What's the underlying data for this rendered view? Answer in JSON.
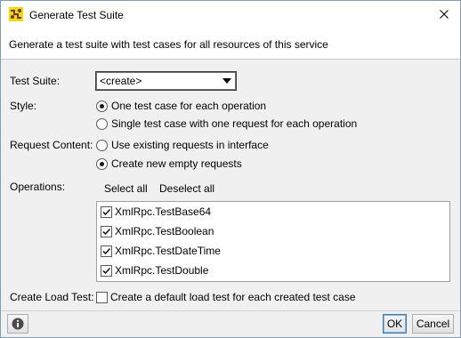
{
  "window": {
    "title": "Generate Test Suite"
  },
  "banner": {
    "text": "Generate a test suite with test cases for all resources of this service"
  },
  "form": {
    "test_suite_label": "Test Suite:",
    "test_suite_value": "<create>",
    "style_label": "Style:",
    "style_options": [
      {
        "label": "One test case for each operation",
        "selected": true
      },
      {
        "label": "Single test case with one request for each operation",
        "selected": false
      }
    ],
    "request_content_label": "Request Content:",
    "request_content_options": [
      {
        "label": "Use existing requests in interface",
        "selected": false
      },
      {
        "label": "Create new empty requests",
        "selected": true
      }
    ],
    "operations_label": "Operations:",
    "select_all": "Select all",
    "deselect_all": "Deselect all",
    "operations": [
      {
        "label": "XmlRpc.TestBase64",
        "checked": true
      },
      {
        "label": "XmlRpc.TestBoolean",
        "checked": true
      },
      {
        "label": "XmlRpc.TestDateTime",
        "checked": true
      },
      {
        "label": "XmlRpc.TestDouble",
        "checked": true
      }
    ],
    "create_load_test_label": "Create Load Test:",
    "create_load_test_option": "Create a default load test for each created test case",
    "create_load_test_checked": false
  },
  "buttons": {
    "ok": "OK",
    "cancel": "Cancel"
  },
  "colors": {
    "accent": "#3c7fb1",
    "icon_yellow": "#f5d800",
    "icon_brown": "#6b3a00",
    "help_icon": "#4a4a4a"
  }
}
